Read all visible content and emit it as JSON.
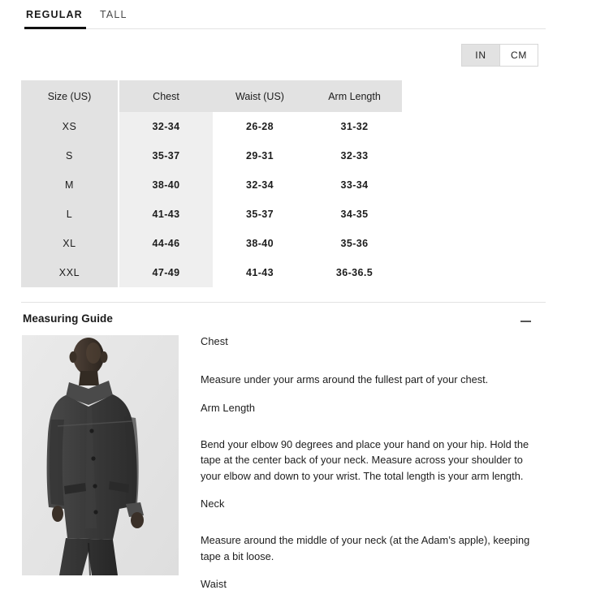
{
  "tabs": [
    {
      "label": "REGULAR",
      "active": true
    },
    {
      "label": "TALL",
      "active": false
    }
  ],
  "units": {
    "options": [
      {
        "label": "IN",
        "selected": true
      },
      {
        "label": "CM",
        "selected": false
      }
    ]
  },
  "size_table": {
    "headers": [
      "Size (US)",
      "Chest",
      "Waist (US)",
      "Arm Length"
    ],
    "rows": [
      {
        "size": "XS",
        "chest": "32-34",
        "waist": "26-28",
        "arm": "31-32"
      },
      {
        "size": "S",
        "chest": "35-37",
        "waist": "29-31",
        "arm": "32-33"
      },
      {
        "size": "M",
        "chest": "38-40",
        "waist": "32-34",
        "arm": "33-34"
      },
      {
        "size": "L",
        "chest": "41-43",
        "waist": "35-37",
        "arm": "34-35"
      },
      {
        "size": "XL",
        "chest": "44-46",
        "waist": "38-40",
        "arm": "35-36"
      },
      {
        "size": "XXL",
        "chest": "47-49",
        "waist": "41-43",
        "arm": "36-36.5"
      }
    ]
  },
  "measuring_guide": {
    "title": "Measuring Guide",
    "collapse_icon": "minus-icon",
    "photo_alt": "male-model-in-dark-wool-jacket",
    "sections": [
      {
        "heading": "Chest",
        "body": "Measure under your arms around the fullest part of your chest."
      },
      {
        "heading": "Arm Length",
        "body": "Bend your elbow 90 degrees and place your hand on your hip. Hold the tape at the center back of your neck. Measure across your shoulder to your elbow and down to your wrist. The total length is your arm length."
      },
      {
        "heading": "Neck",
        "body": "Measure around the middle of your neck (at the Adam’s apple), keeping tape a bit loose."
      },
      {
        "heading": "Waist",
        "body": ""
      }
    ]
  },
  "colors": {
    "header_bg": "#e2e2e2",
    "size_col_bg": "#e2e2e2",
    "chest_col_bg": "#efefef",
    "active_tab_underline": "#111111",
    "divider": "#e3e3e3",
    "text": "#1d1d1d"
  }
}
